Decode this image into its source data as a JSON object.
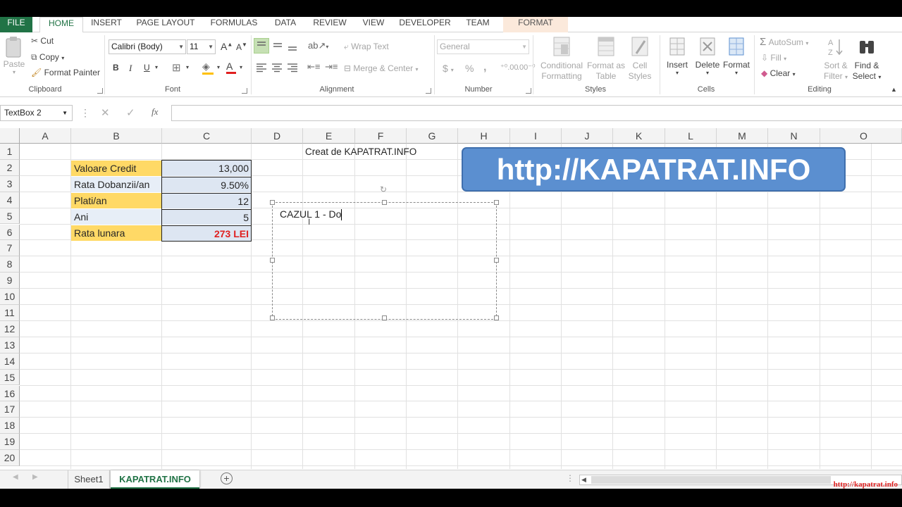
{
  "ribbon_tabs": [
    "FILE",
    "HOME",
    "INSERT",
    "PAGE LAYOUT",
    "FORMULAS",
    "DATA",
    "REVIEW",
    "VIEW",
    "DEVELOPER",
    "TEAM",
    "FORMAT"
  ],
  "clipboard": {
    "paste": "Paste",
    "cut": "Cut",
    "copy": "Copy",
    "format_painter": "Format Painter",
    "label": "Clipboard"
  },
  "font": {
    "name": "Calibri (Body)",
    "size": "11",
    "bold": "B",
    "italic": "I",
    "underline": "U",
    "label": "Font"
  },
  "alignment": {
    "wrap_text": "Wrap Text",
    "merge_center": "Merge & Center",
    "label": "Alignment"
  },
  "number": {
    "format": "General",
    "currency": "$",
    "percent": "%",
    "comma": ",",
    "label": "Number"
  },
  "styles": {
    "conditional_l1": "Conditional",
    "conditional_l2": "Formatting",
    "format_table_l1": "Format as",
    "format_table_l2": "Table",
    "cell_styles_l1": "Cell",
    "cell_styles_l2": "Styles",
    "label": "Styles"
  },
  "cells": {
    "insert": "Insert",
    "delete": "Delete",
    "format": "Format",
    "label": "Cells"
  },
  "editing": {
    "autosum": "AutoSum",
    "fill": "Fill",
    "clear": "Clear",
    "sort_l1": "Sort &",
    "sort_l2": "Filter",
    "find_l1": "Find &",
    "find_l2": "Select",
    "label": "Editing"
  },
  "formula_bar": {
    "name_box": "TextBox 2",
    "fx": "fx",
    "formula": ""
  },
  "columns": [
    "A",
    "B",
    "C",
    "D",
    "E",
    "F",
    "G",
    "H",
    "I",
    "J",
    "K",
    "L",
    "M",
    "N",
    "O"
  ],
  "rows": [
    "1",
    "2",
    "3",
    "4",
    "5",
    "6",
    "7",
    "8",
    "9",
    "10",
    "11",
    "12",
    "13",
    "14",
    "15",
    "16",
    "17",
    "18",
    "19",
    "20"
  ],
  "cells_data": {
    "e1": "Creat de KAPATRAT.INFO",
    "b2": "Valoare Credit",
    "c2": "13,000",
    "b3": "Rata Dobanzii/an",
    "c3": "9.50%",
    "b4": "Plati/an",
    "c4": "12",
    "b5": "Ani",
    "c5": "5",
    "b6": "Rata lunara",
    "c6": "273 LEI"
  },
  "textbox": {
    "text": "CAZUL 1 - Do"
  },
  "banner": {
    "text": "http://KAPATRAT.INFO"
  },
  "sheets": [
    "Sheet1",
    "KAPATRAT.INFO"
  ],
  "active_sheet": "KAPATRAT.INFO",
  "watermark": "http://kapatrat.info",
  "colors": {
    "excel_green": "#217346",
    "yellow_fill": "#ffd966",
    "blue_fill": "#dde6f2",
    "banner": "#5b8fd0",
    "result_red": "#e02020"
  }
}
